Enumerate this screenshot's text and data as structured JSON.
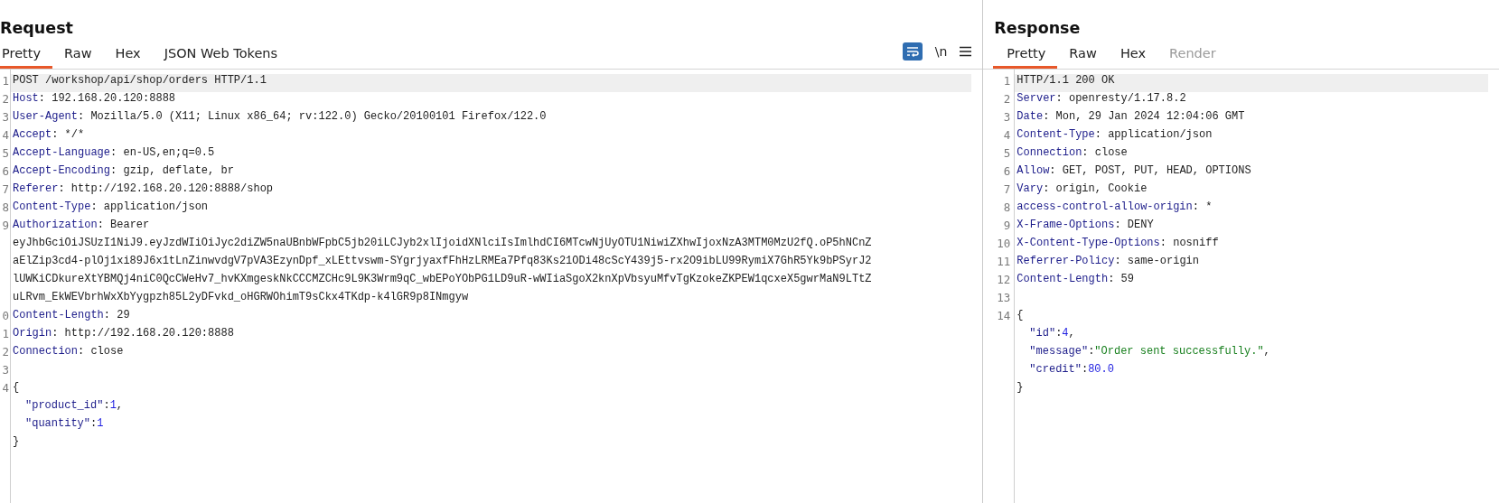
{
  "request": {
    "title": "Request",
    "tabs": [
      {
        "label": "Pretty",
        "selected": true,
        "disabled": false
      },
      {
        "label": "Raw",
        "selected": false,
        "disabled": false
      },
      {
        "label": "Hex",
        "selected": false,
        "disabled": false
      },
      {
        "label": "JSON Web Tokens",
        "selected": false,
        "disabled": false
      }
    ],
    "toolbar": {
      "wrap_on": true,
      "newline_label": "\\n"
    },
    "lines": [
      {
        "number": "1",
        "highlighted": true,
        "segments": [
          {
            "kind": "plain",
            "text": "POST /workshop/api/shop/orders HTTP/1.1"
          }
        ]
      },
      {
        "number": "2",
        "highlighted": false,
        "segments": [
          {
            "kind": "name",
            "text": "Host"
          },
          {
            "kind": "plain",
            "text": ": 192.168.20.120:8888"
          }
        ]
      },
      {
        "number": "3",
        "highlighted": false,
        "segments": [
          {
            "kind": "name",
            "text": "User-Agent"
          },
          {
            "kind": "plain",
            "text": ": Mozilla/5.0 (X11; Linux x86_64; rv:122.0) Gecko/20100101 Firefox/122.0"
          }
        ]
      },
      {
        "number": "4",
        "highlighted": false,
        "segments": [
          {
            "kind": "name",
            "text": "Accept"
          },
          {
            "kind": "plain",
            "text": ": */*"
          }
        ]
      },
      {
        "number": "5",
        "highlighted": false,
        "segments": [
          {
            "kind": "name",
            "text": "Accept-Language"
          },
          {
            "kind": "plain",
            "text": ": en-US,en;q=0.5"
          }
        ]
      },
      {
        "number": "6",
        "highlighted": false,
        "segments": [
          {
            "kind": "name",
            "text": "Accept-Encoding"
          },
          {
            "kind": "plain",
            "text": ": gzip, deflate, br"
          }
        ]
      },
      {
        "number": "7",
        "highlighted": false,
        "segments": [
          {
            "kind": "name",
            "text": "Referer"
          },
          {
            "kind": "plain",
            "text": ": http://192.168.20.120:8888/shop"
          }
        ]
      },
      {
        "number": "8",
        "highlighted": false,
        "segments": [
          {
            "kind": "name",
            "text": "Content-Type"
          },
          {
            "kind": "plain",
            "text": ": application/json"
          }
        ]
      },
      {
        "number": "9",
        "highlighted": false,
        "segments": [
          {
            "kind": "name",
            "text": "Authorization"
          },
          {
            "kind": "plain",
            "text": ": Bearer"
          }
        ]
      },
      {
        "highlighted": false,
        "segments": [
          {
            "kind": "plain",
            "text": "eyJhbGciOiJSUzI1NiJ9.eyJzdWIiOiJyc2diZW5naUBnbWFpbC5jb20iLCJyb2xlIjoidXNlciIsImlhdCI6MTcwNjUyOTU1NiwiZXhwIjoxNzA3MTM0MzU2fQ.oP5hNCnZ"
          }
        ]
      },
      {
        "highlighted": false,
        "segments": [
          {
            "kind": "plain",
            "text": "aElZip3cd4-plOj1xi89J6x1tLnZinwvdgV7pVA3EzynDpf_xLEttvswm-SYgrjyaxfFhHzLRMEa7Pfq83Ks21ODi48cScY439j5-rx2O9ibLU99RymiX7GhR5Yk9bPSyrJ2"
          }
        ]
      },
      {
        "highlighted": false,
        "segments": [
          {
            "kind": "plain",
            "text": "lUWKiCDkureXtYBMQj4niC0QcCWeHv7_hvKXmgeskNkCCCMZCHc9L9K3Wrm9qC_wbEPoYObPG1LD9uR-wWIiaSgoX2knXpVbsyuMfvTgKzokeZKPEW1qcxeX5gwrMaN9LTtZ"
          }
        ]
      },
      {
        "highlighted": false,
        "segments": [
          {
            "kind": "plain",
            "text": "uLRvm_EkWEVbrhWxXbYygpzh85L2yDFvkd_oHGRWOhimT9sCkx4TKdp-k4lGR9p8INmgyw"
          }
        ]
      },
      {
        "number": "0",
        "highlighted": false,
        "segments": [
          {
            "kind": "name",
            "text": "Content-Length"
          },
          {
            "kind": "plain",
            "text": ": 29"
          }
        ]
      },
      {
        "number": "1",
        "highlighted": false,
        "segments": [
          {
            "kind": "name",
            "text": "Origin"
          },
          {
            "kind": "plain",
            "text": ": http://192.168.20.120:8888"
          }
        ]
      },
      {
        "number": "2",
        "highlighted": false,
        "segments": [
          {
            "kind": "name",
            "text": "Connection"
          },
          {
            "kind": "plain",
            "text": ": close"
          }
        ]
      },
      {
        "number": "3",
        "highlighted": false
      },
      {
        "number": "4",
        "highlighted": false,
        "segments": [
          {
            "kind": "plain",
            "text": "{"
          }
        ]
      },
      {
        "highlighted": false,
        "indented": true,
        "segments": [
          {
            "kind": "key",
            "text": "\"product_id\""
          },
          {
            "kind": "plain",
            "text": ":"
          },
          {
            "kind": "number",
            "text": "1"
          },
          {
            "kind": "plain",
            "text": ","
          }
        ]
      },
      {
        "highlighted": false,
        "indented": true,
        "segments": [
          {
            "kind": "key",
            "text": "\"quantity\""
          },
          {
            "kind": "plain",
            "text": ":"
          },
          {
            "kind": "number",
            "text": "1"
          }
        ]
      },
      {
        "highlighted": false,
        "segments": [
          {
            "kind": "plain",
            "text": "}"
          }
        ]
      }
    ]
  },
  "response": {
    "title": "Response",
    "tabs": [
      {
        "label": "Pretty",
        "selected": true,
        "disabled": false
      },
      {
        "label": "Raw",
        "selected": false,
        "disabled": false
      },
      {
        "label": "Hex",
        "selected": false,
        "disabled": false
      },
      {
        "label": "Render",
        "selected": false,
        "disabled": true
      }
    ],
    "lines": [
      {
        "number": "1",
        "highlighted": true,
        "segments": [
          {
            "kind": "plain",
            "text": "HTTP/1.1 200 OK"
          }
        ]
      },
      {
        "number": "2",
        "highlighted": false,
        "segments": [
          {
            "kind": "name",
            "text": "Server"
          },
          {
            "kind": "plain",
            "text": ": openresty/1.17.8.2"
          }
        ]
      },
      {
        "number": "3",
        "highlighted": false,
        "segments": [
          {
            "kind": "name",
            "text": "Date"
          },
          {
            "kind": "plain",
            "text": ": Mon, 29 Jan 2024 12:04:06 GMT"
          }
        ]
      },
      {
        "number": "4",
        "highlighted": false,
        "segments": [
          {
            "kind": "name",
            "text": "Content-Type"
          },
          {
            "kind": "plain",
            "text": ": application/json"
          }
        ]
      },
      {
        "number": "5",
        "highlighted": false,
        "segments": [
          {
            "kind": "name",
            "text": "Connection"
          },
          {
            "kind": "plain",
            "text": ": close"
          }
        ]
      },
      {
        "number": "6",
        "highlighted": false,
        "segments": [
          {
            "kind": "name",
            "text": "Allow"
          },
          {
            "kind": "plain",
            "text": ": GET, POST, PUT, HEAD, OPTIONS"
          }
        ]
      },
      {
        "number": "7",
        "highlighted": false,
        "segments": [
          {
            "kind": "name",
            "text": "Vary"
          },
          {
            "kind": "plain",
            "text": ": origin, Cookie"
          }
        ]
      },
      {
        "number": "8",
        "highlighted": false,
        "segments": [
          {
            "kind": "name",
            "text": "access-control-allow-origin"
          },
          {
            "kind": "plain",
            "text": ": *"
          }
        ]
      },
      {
        "number": "9",
        "highlighted": false,
        "segments": [
          {
            "kind": "name",
            "text": "X-Frame-Options"
          },
          {
            "kind": "plain",
            "text": ": DENY"
          }
        ]
      },
      {
        "number": "10",
        "highlighted": false,
        "segments": [
          {
            "kind": "name",
            "text": "X-Content-Type-Options"
          },
          {
            "kind": "plain",
            "text": ": nosniff"
          }
        ]
      },
      {
        "number": "11",
        "highlighted": false,
        "segments": [
          {
            "kind": "name",
            "text": "Referrer-Policy"
          },
          {
            "kind": "plain",
            "text": ": same-origin"
          }
        ]
      },
      {
        "number": "12",
        "highlighted": false,
        "segments": [
          {
            "kind": "name",
            "text": "Content-Length"
          },
          {
            "kind": "plain",
            "text": ": 59"
          }
        ]
      },
      {
        "number": "13",
        "highlighted": false
      },
      {
        "number": "14",
        "highlighted": false,
        "segments": [
          {
            "kind": "plain",
            "text": "{"
          }
        ]
      },
      {
        "highlighted": false,
        "indented": true,
        "segments": [
          {
            "kind": "key",
            "text": "\"id\""
          },
          {
            "kind": "plain",
            "text": ":"
          },
          {
            "kind": "number",
            "text": "4"
          },
          {
            "kind": "plain",
            "text": ","
          }
        ]
      },
      {
        "highlighted": false,
        "indented": true,
        "segments": [
          {
            "kind": "key",
            "text": "\"message\""
          },
          {
            "kind": "plain",
            "text": ":"
          },
          {
            "kind": "string",
            "text": "\"Order sent successfully.\""
          },
          {
            "kind": "plain",
            "text": ","
          }
        ]
      },
      {
        "highlighted": false,
        "indented": true,
        "segments": [
          {
            "kind": "key",
            "text": "\"credit\""
          },
          {
            "kind": "plain",
            "text": ":"
          },
          {
            "kind": "number",
            "text": "80.0"
          }
        ]
      },
      {
        "highlighted": false,
        "segments": [
          {
            "kind": "plain",
            "text": "}"
          }
        ]
      }
    ]
  }
}
